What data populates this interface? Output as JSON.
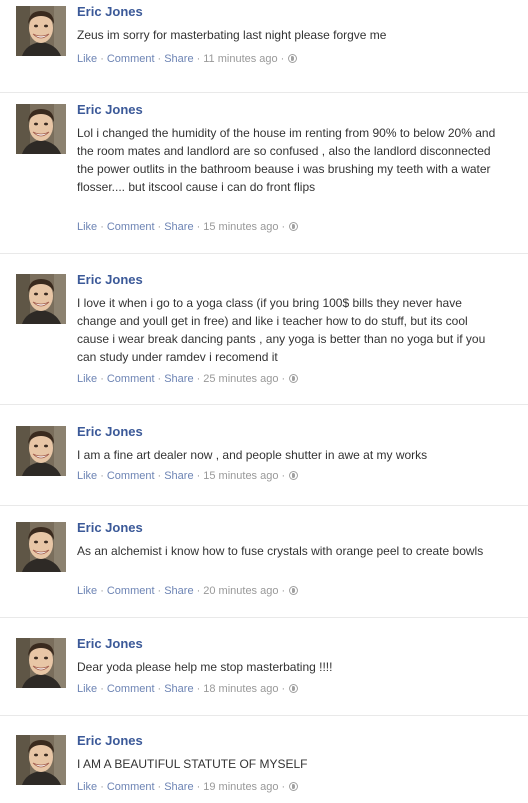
{
  "actions": {
    "like": "Like",
    "comment": "Comment",
    "share": "Share"
  },
  "posts": [
    {
      "author": "Eric Jones",
      "text": "Zeus im sorry for masterbating last night please forgve me",
      "time": "11 minutes ago"
    },
    {
      "author": "Eric Jones",
      "text": "Lol i changed the humidity of the house im renting from 90% to below 20% and the room mates and landlord are so confused , also the landlord disconnected the power outlits in the bathroom beause i was brushing my teeth with a water flosser.... but itscool cause i can do front flips",
      "time": "15 minutes ago"
    },
    {
      "author": "Eric Jones",
      "text": "I love it when i go to a yoga class (if you bring 100$ bills they never have change and youll get in free) and like i teacher how to do stuff, but its cool cause i wear break dancing pants , any yoga is better than no yoga but if you can study under ramdev i recomend it",
      "time": "25 minutes ago"
    },
    {
      "author": "Eric Jones",
      "text": "I am a fine art dealer now , and people shutter in awe at my works",
      "time": "15 minutes ago"
    },
    {
      "author": "Eric Jones",
      "text": "As an alchemist i know how to fuse crystals with orange peel to create bowls",
      "time": "20 minutes ago"
    },
    {
      "author": "Eric Jones",
      "text": "Dear yoda please help me stop masterbating !!!!",
      "time": "18 minutes ago"
    },
    {
      "author": "Eric Jones",
      "text": "I AM A BEAUTIFUL STATUTE OF MYSELF",
      "time": "19 minutes ago"
    }
  ]
}
